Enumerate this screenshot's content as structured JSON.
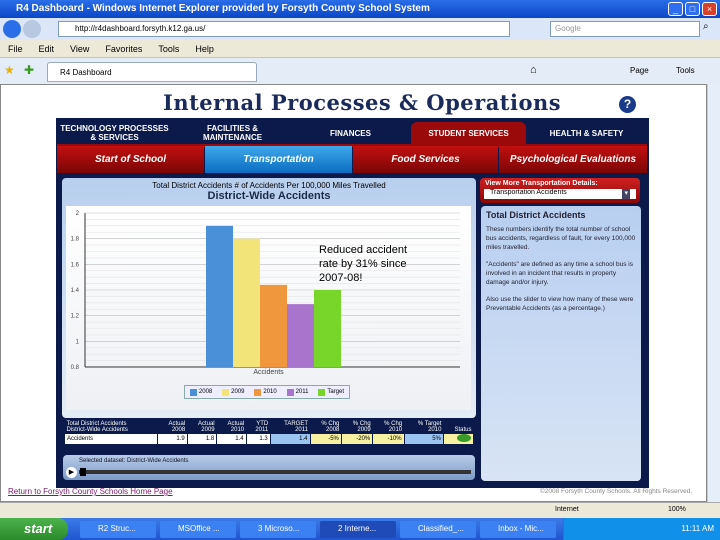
{
  "window": {
    "title": "R4 Dashboard - Windows Internet Explorer provided by Forsyth County School System"
  },
  "browser": {
    "url": "http://r4dashboard.forsyth.k12.ga.us/",
    "search_placeholder": "Google",
    "tab_title": "R4 Dashboard",
    "menu": [
      "File",
      "Edit",
      "View",
      "Favorites",
      "Tools",
      "Help"
    ],
    "cmd_page": "Page",
    "cmd_tools": "Tools"
  },
  "page": {
    "title": "Internal Processes & Operations",
    "help": "?",
    "main_tabs": [
      "TECHNOLOGY PROCESSES & SERVICES",
      "FACILITIES & MAINTENANCE",
      "FINANCES",
      "STUDENT SERVICES",
      "HEALTH & SAFETY"
    ],
    "sub_tabs": [
      "Start of School",
      "Transportation",
      "Food Services",
      "Psychological Evaluations"
    ],
    "chart_header": "Total District Accidents   # of Accidents Per 100,000 Miles Travelled",
    "details": {
      "label": "View More Transportation Details:",
      "selected": "Transportation Accidents"
    },
    "info": {
      "title": "Total District Accidents",
      "paragraphs": [
        "These numbers identify the total number of school bus accidents, regardless of fault, for every 100,000 miles travelled.",
        "\"Accidents\" are defined as any time a school bus is involved in an incident that results in property damage and/or injury.",
        "Also use the slider to view how many of these were Preventable Accidents (as a percentage.)"
      ]
    },
    "table": {
      "headers1": [
        "Total District Accidents",
        "Actual",
        "Actual",
        "Actual",
        "YTD",
        "TARGET",
        "% Chg",
        "% Chg",
        "% Chg",
        "% Target",
        ""
      ],
      "headers2": [
        "District-Wide Accidents",
        "2008",
        "2009",
        "2010",
        "2011",
        "2011",
        "2008",
        "2009",
        "2010",
        "2010",
        "Status"
      ],
      "row": [
        "Accidents",
        "1.9",
        "1.8",
        "1.4",
        "1.3",
        "1.4",
        "-5%",
        "-20%",
        "-10%",
        "5%",
        ""
      ]
    },
    "slider_label": "Selected dataset: District-Wide Accidents",
    "footer_link": "Return to Forsyth County Schools Home Page",
    "copyright": "©2008 Forsyth County Schools. All Rights Reserved."
  },
  "status": {
    "zone": "Internet",
    "zoom": "100%"
  },
  "taskbar": {
    "start": "start",
    "items": [
      "R2 Struc...",
      "MSOffice ...",
      "3 Microso...",
      "2 Interne...",
      "Classified_...",
      "Inbox - Mic..."
    ],
    "clock": "11:11 AM"
  },
  "chart_data": {
    "type": "bar",
    "title": "District-Wide Accidents",
    "xlabel": "Accidents",
    "categories": [
      "Accidents"
    ],
    "series": [
      {
        "name": "2008",
        "values": [
          1.9
        ],
        "color": "#4a90d9"
      },
      {
        "name": "2009",
        "values": [
          1.8
        ],
        "color": "#f3e47a"
      },
      {
        "name": "2010",
        "values": [
          1.44
        ],
        "color": "#f0973e"
      },
      {
        "name": "2011",
        "values": [
          1.29
        ],
        "color": "#a874cc"
      },
      {
        "name": "Target",
        "values": [
          1.4
        ],
        "color": "#78d62a"
      }
    ],
    "ylim": [
      0.8,
      2
    ],
    "yticks": [
      "2",
      "1.8",
      "1.6",
      "1.4",
      "1.2",
      "1",
      "0.8"
    ],
    "grid": true,
    "legend": "bottom",
    "annotation": "Reduced accident rate by 31% since 2007-08!"
  }
}
